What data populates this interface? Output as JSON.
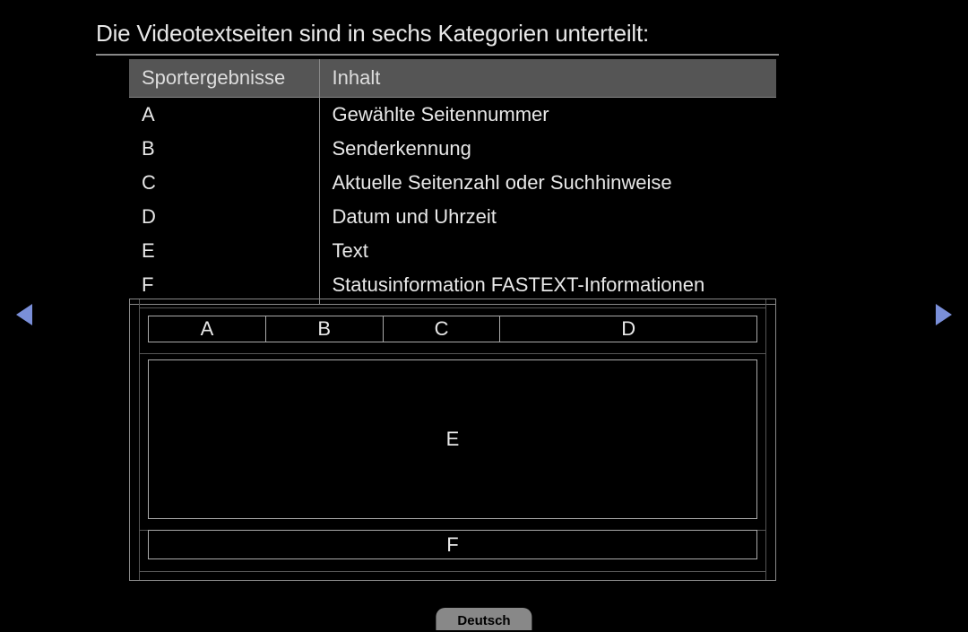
{
  "heading": "Die Videotextseiten sind in sechs Kategorien unterteilt:",
  "table": {
    "header": {
      "col1": "Sportergebnisse",
      "col2": "Inhalt"
    },
    "rows": [
      {
        "key": "A",
        "desc": "Gewählte Seitennummer"
      },
      {
        "key": "B",
        "desc": "Senderkennung"
      },
      {
        "key": "C",
        "desc": "Aktuelle Seitenzahl oder Suchhinweise"
      },
      {
        "key": "D",
        "desc": "Datum und Uhrzeit"
      },
      {
        "key": "E",
        "desc": "Text"
      },
      {
        "key": "F",
        "desc": "Statusinformation FASTEXT-Informationen"
      }
    ]
  },
  "layout": {
    "top": {
      "A": "A",
      "B": "B",
      "C": "C",
      "D": "D"
    },
    "E": "E",
    "F": "F"
  },
  "footer": {
    "language": "Deutsch"
  }
}
